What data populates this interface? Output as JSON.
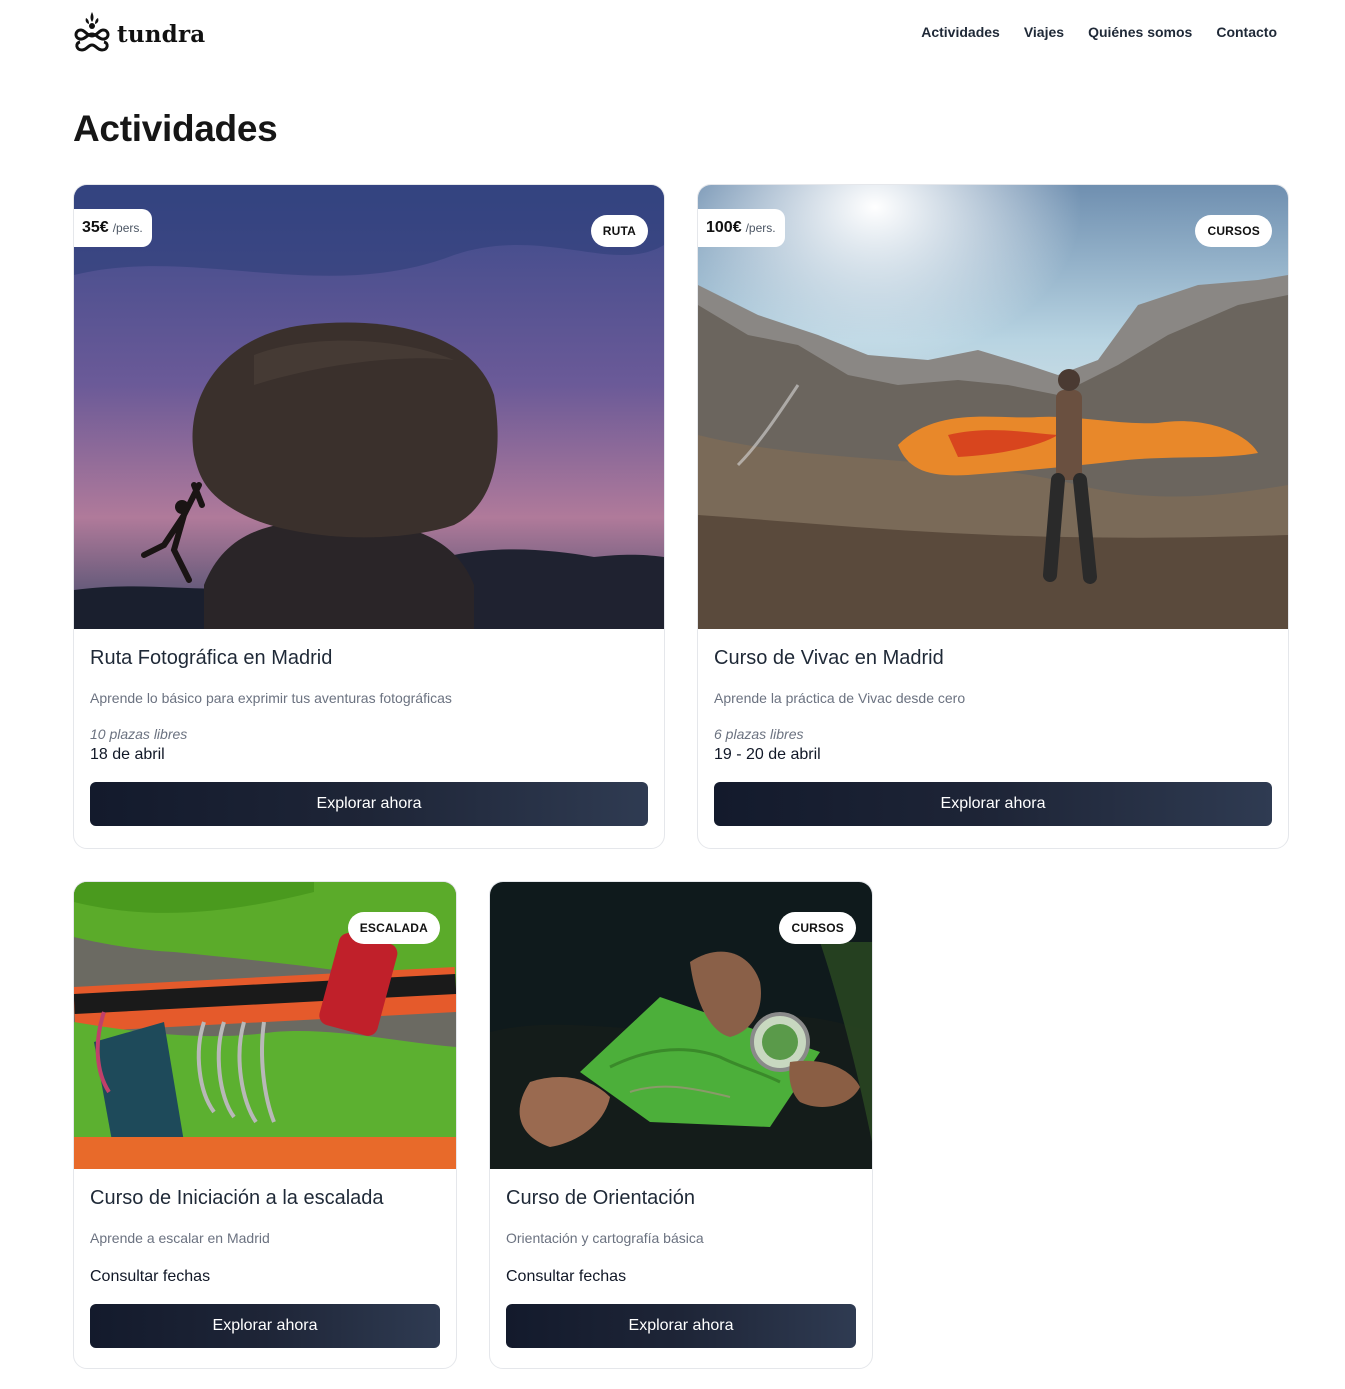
{
  "brand": {
    "name": "tundra"
  },
  "nav": {
    "items": [
      {
        "label": "Actividades"
      },
      {
        "label": "Viajes"
      },
      {
        "label": "Quiénes somos"
      },
      {
        "label": "Contacto"
      }
    ]
  },
  "page": {
    "title": "Actividades"
  },
  "cards": [
    {
      "price": "35€",
      "price_unit": "/pers.",
      "badge": "RUTA",
      "title": "Ruta Fotográfica en Madrid",
      "description": "Aprende lo básico para exprimir tus aventuras fotográficas",
      "spots": "10 plazas libres",
      "date": "18 de abril",
      "button": "Explorar ahora"
    },
    {
      "price": "100€",
      "price_unit": "/pers.",
      "badge": "CURSOS",
      "title": "Curso de Vivac en Madrid",
      "description": "Aprende la práctica de Vivac desde cero",
      "spots": "6 plazas libres",
      "date": "19 - 20 de abril",
      "button": "Explorar ahora"
    },
    {
      "badge": "ESCALADA",
      "title": "Curso de Iniciación a la escalada",
      "description": "Aprende a escalar en Madrid",
      "date": "Consultar fechas",
      "button": "Explorar ahora"
    },
    {
      "badge": "CURSOS",
      "title": "Curso de Orientación",
      "description": "Orientación y cartografía básica",
      "date": "Consultar fechas",
      "button": "Explorar ahora"
    }
  ]
}
